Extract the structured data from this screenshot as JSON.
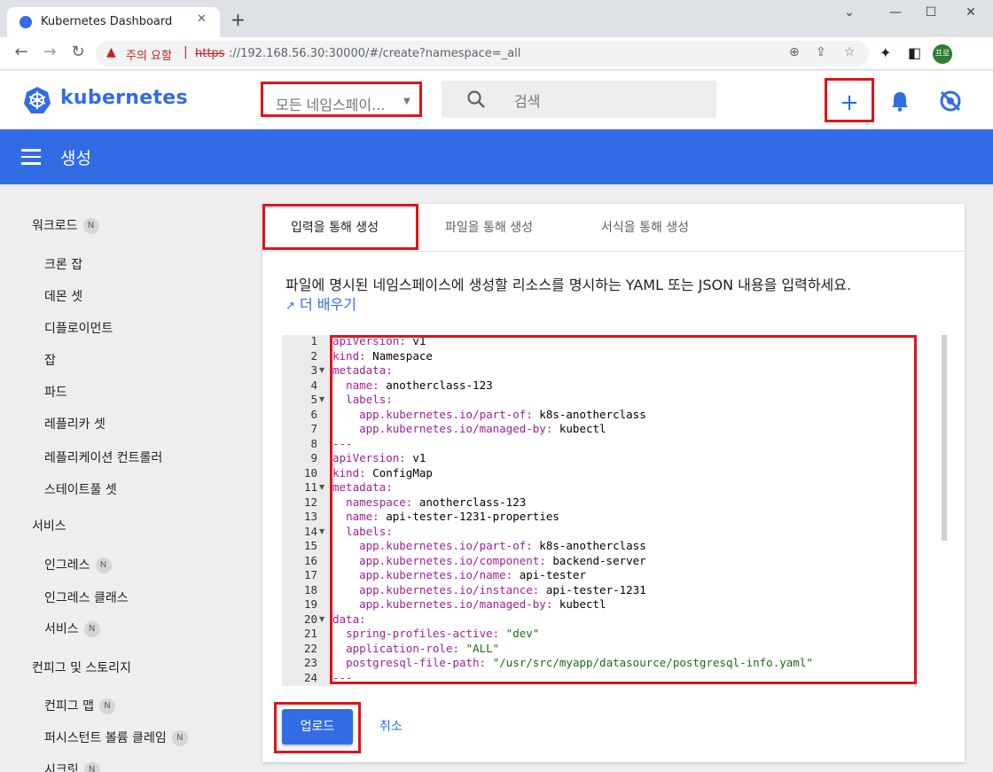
{
  "browser": {
    "tab_title": "Kubernetes Dashboard",
    "tab_close": "✕",
    "new_tab": "+",
    "win_min": "⌄",
    "win_minimize": "—",
    "win_maximize": "☐",
    "win_close": "✕",
    "security_warning": "주의 요함",
    "url_scheme": "https",
    "url_rest": "://192.168.56.30:30000/#/create?namespace=_all",
    "profile_label": "프로"
  },
  "header": {
    "logo_text": "kubernetes",
    "namespace_select": "모든 네임스페이...",
    "search_placeholder": "검색",
    "create_button": "+"
  },
  "page": {
    "title": "생성"
  },
  "sidebar": {
    "groups": [
      {
        "label": "워크로드",
        "badge": "N"
      },
      {
        "label": "서비스"
      },
      {
        "label": "컨피그 및 스토리지"
      }
    ],
    "workload_items": [
      {
        "label": "크론 잡"
      },
      {
        "label": "데몬 셋"
      },
      {
        "label": "디플로이먼트"
      },
      {
        "label": "잡"
      },
      {
        "label": "파드"
      },
      {
        "label": "레플리카 셋"
      },
      {
        "label": "레플리케이션 컨트롤러"
      },
      {
        "label": "스테이트풀 셋"
      }
    ],
    "service_items": [
      {
        "label": "인그레스",
        "badge": "N"
      },
      {
        "label": "인그레스 클래스"
      },
      {
        "label": "서비스",
        "badge": "N"
      }
    ],
    "config_items": [
      {
        "label": "컨피그 맵",
        "badge": "N"
      },
      {
        "label": "퍼시스턴트 볼륨 클레임",
        "badge": "N"
      },
      {
        "label": "시크릿",
        "badge": "N"
      }
    ]
  },
  "create": {
    "tabs": [
      {
        "label": "입력을 통해 생성",
        "active": true
      },
      {
        "label": "파일을 통해 생성"
      },
      {
        "label": "서식을 통해 생성"
      }
    ],
    "description": "파일에 명시된 네임스페이스에 생성할 리소스를 명시하는 YAML 또는 JSON 내용을 입력하세요.",
    "learn_more": "더 배우기",
    "upload_button": "업로드",
    "cancel_button": "취소"
  },
  "editor": {
    "lines": [
      "apiVersion: v1",
      "kind: Namespace",
      "metadata:",
      "  name: anotherclass-123",
      "  labels:",
      "    app.kubernetes.io/part-of: k8s-anotherclass",
      "    app.kubernetes.io/managed-by: kubectl",
      "---",
      "apiVersion: v1",
      "kind: ConfigMap",
      "metadata:",
      "  namespace: anotherclass-123",
      "  name: api-tester-1231-properties",
      "  labels:",
      "    app.kubernetes.io/part-of: k8s-anotherclass",
      "    app.kubernetes.io/component: backend-server",
      "    app.kubernetes.io/name: api-tester",
      "    app.kubernetes.io/instance: api-tester-1231",
      "    app.kubernetes.io/managed-by: kubectl",
      "data:",
      "  spring-profiles-active: \"dev\"",
      "  application-role: \"ALL\"",
      "  postgresql-file-path: \"/usr/src/myapp/datasource/postgresql-info.yaml\"",
      "---"
    ],
    "fold_lines": [
      3,
      5,
      11,
      14,
      20
    ]
  },
  "colors": {
    "brand": "#326ce5",
    "highlight": "#e0131b"
  }
}
